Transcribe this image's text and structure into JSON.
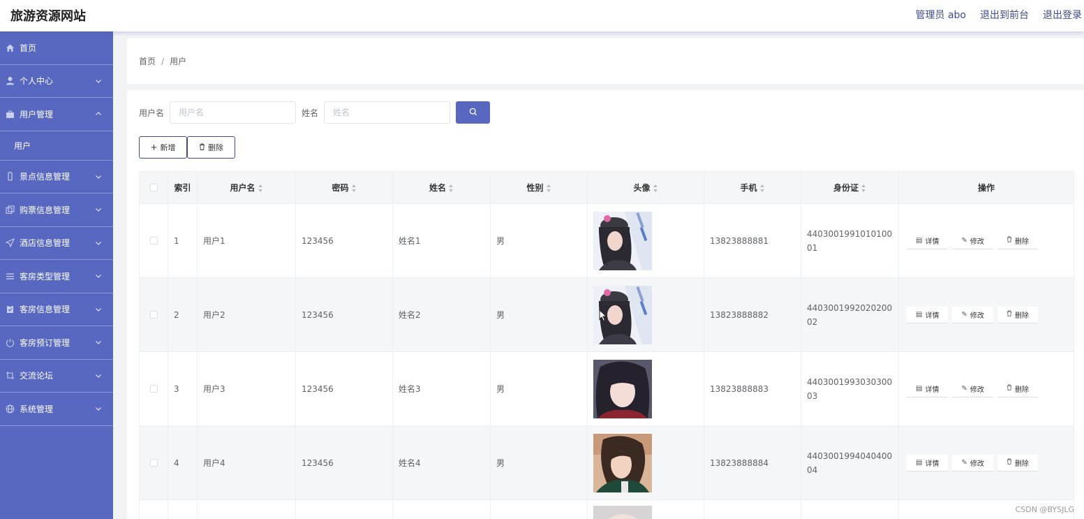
{
  "header": {
    "title": "旅游资源网站",
    "admin_label": "管理员 abo",
    "to_front": "退出到前台",
    "logout": "退出登录"
  },
  "sidebar": {
    "items": [
      {
        "label": "首页",
        "icon": "home-icon"
      },
      {
        "label": "个人中心",
        "icon": "user-icon"
      },
      {
        "label": "用户管理",
        "icon": "briefcase-icon",
        "expanded": true
      },
      {
        "label": "景点信息管理",
        "icon": "phone-icon"
      },
      {
        "label": "购票信息管理",
        "icon": "copy-icon"
      },
      {
        "label": "酒店信息管理",
        "icon": "send-icon"
      },
      {
        "label": "客房类型管理",
        "icon": "list-icon"
      },
      {
        "label": "客房信息管理",
        "icon": "clipboard-icon"
      },
      {
        "label": "客房预订管理",
        "icon": "power-icon"
      },
      {
        "label": "交流论坛",
        "icon": "crop-icon"
      },
      {
        "label": "系统管理",
        "icon": "globe-icon"
      }
    ],
    "sub_items": [
      {
        "label": "用户"
      }
    ]
  },
  "breadcrumb": {
    "home": "首页",
    "separator": "/",
    "current": "用户"
  },
  "search": {
    "username_label": "用户名",
    "username_placeholder": "用户名",
    "name_label": "姓名",
    "name_placeholder": "姓名"
  },
  "actions": {
    "add": "新增",
    "delete": "删除"
  },
  "table": {
    "columns": [
      "索引",
      "用户名",
      "密码",
      "姓名",
      "性别",
      "头像",
      "手机",
      "身份证",
      "操作"
    ],
    "rows": [
      {
        "index": "1",
        "username": "用户1",
        "password": "123456",
        "name": "姓名1",
        "gender": "男",
        "phone": "13823888881",
        "idcard": "440300199101010001",
        "avatar": "cap"
      },
      {
        "index": "2",
        "username": "用户2",
        "password": "123456",
        "name": "姓名2",
        "gender": "男",
        "phone": "13823888882",
        "idcard": "440300199202020002",
        "avatar": "cap"
      },
      {
        "index": "3",
        "username": "用户3",
        "password": "123456",
        "name": "姓名3",
        "gender": "男",
        "phone": "13823888883",
        "idcard": "440300199303030003",
        "avatar": "dark"
      },
      {
        "index": "4",
        "username": "用户4",
        "password": "123456",
        "name": "姓名4",
        "gender": "男",
        "phone": "13823888884",
        "idcard": "440300199404040004",
        "avatar": "green"
      }
    ],
    "row_actions": {
      "detail": "详情",
      "edit": "修改",
      "delete": "删除"
    }
  },
  "watermark": "CSDN @BYSJLG",
  "colors": {
    "primary": "#5867c0",
    "sidebar_bg": "#5867c0",
    "border": "#ebeef5"
  }
}
